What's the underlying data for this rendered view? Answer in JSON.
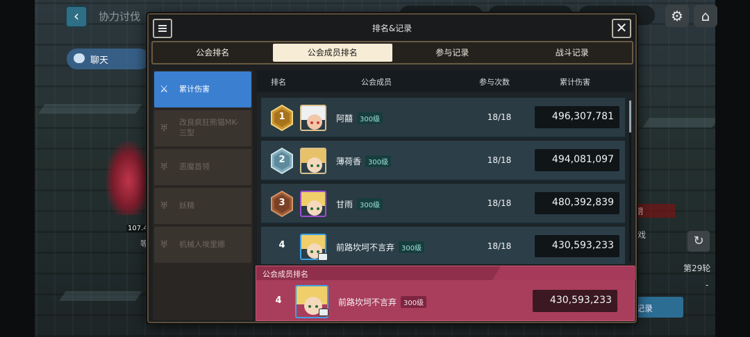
{
  "background": {
    "screen_title": "协力讨伐",
    "chat_label": "聊天",
    "round_label": "第29轮",
    "records_label": "记录",
    "red_label": "期",
    "side_text": "戏",
    "dash": "-",
    "damage_float": "107.4",
    "side_char": "等"
  },
  "modal": {
    "title": "排名&记录",
    "close_glyph": "✕"
  },
  "tabs": [
    {
      "label": "公会排名",
      "active": false
    },
    {
      "label": "公会成员排名",
      "active": true
    },
    {
      "label": "参与记录",
      "active": false
    },
    {
      "label": "战斗记录",
      "active": false
    }
  ],
  "categories": [
    {
      "label": "累计伤害",
      "active": true,
      "icon": "sword-icon"
    },
    {
      "label": "改良疯狂熊猫MK-三型",
      "active": false,
      "icon": "demon-head-icon"
    },
    {
      "label": "恶魔首领",
      "active": false,
      "icon": "demon-head-icon"
    },
    {
      "label": "妖精",
      "active": false,
      "icon": "demon-head-icon"
    },
    {
      "label": "机械人埃里娜",
      "active": false,
      "icon": "demon-head-icon"
    }
  ],
  "table": {
    "headers": {
      "rank": "排名",
      "member": "公会成员",
      "count": "参与次数",
      "damage": "累计伤害"
    },
    "rows": [
      {
        "rank": "1",
        "medal": "gold",
        "name": "阿囍",
        "level": "300级",
        "count": "18/18",
        "damage": "496,307,781"
      },
      {
        "rank": "2",
        "medal": "silver",
        "name": "薄荷香",
        "level": "300级",
        "count": "18/18",
        "damage": "494,081,097"
      },
      {
        "rank": "3",
        "medal": "bronze",
        "name": "甘雨",
        "level": "300级",
        "count": "18/18",
        "damage": "480,392,839"
      },
      {
        "rank": "4",
        "medal": "none",
        "name": "前路坎坷不言弃",
        "level": "300级",
        "count": "18/18",
        "damage": "430,593,233"
      }
    ]
  },
  "my_rank": {
    "title": "公会成员排名",
    "rank": "4",
    "name": "前路坎坷不言弃",
    "level": "300级",
    "damage": "430,593,233"
  },
  "colors": {
    "gold": "#c8922e",
    "silver": "#7fa9b9",
    "bronze": "#9a5a36",
    "accent_blue": "#3b7fd1",
    "my_rank_bg": "#a93d5c"
  }
}
